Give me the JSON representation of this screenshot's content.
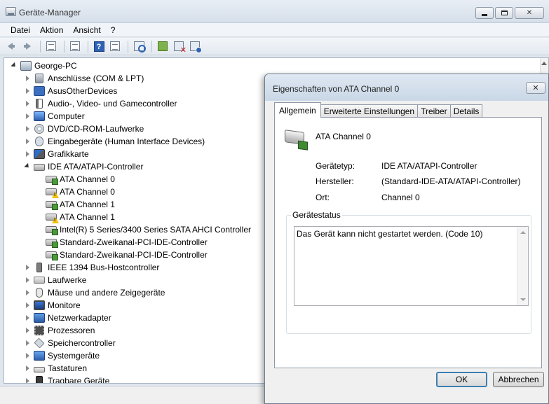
{
  "window": {
    "title": "Geräte-Manager"
  },
  "menu": [
    "Datei",
    "Aktion",
    "Ansicht",
    "?"
  ],
  "toolbar": {
    "buttons": [
      "back-icon",
      "forward-icon",
      "show-hide-console-tree-icon",
      "properties-icon",
      "help-icon",
      "action-pane-icon",
      "scan-hardware-icon",
      "update-driver-icon",
      "uninstall-icon",
      "disable-icon"
    ]
  },
  "tree": {
    "root": "George-PC",
    "items": [
      {
        "label": "Anschlüsse (COM & LPT)",
        "icon": "port"
      },
      {
        "label": "AsusOtherDevices",
        "icon": "misc"
      },
      {
        "label": "Audio-, Video- und Gamecontroller",
        "icon": "audio"
      },
      {
        "label": "Computer",
        "icon": "computer"
      },
      {
        "label": "DVD/CD-ROM-Laufwerke",
        "icon": "dvd"
      },
      {
        "label": "Eingabegeräte (Human Interface Devices)",
        "icon": "hid"
      },
      {
        "label": "Grafikkarte",
        "icon": "gpu"
      },
      {
        "label": "IDE ATA/ATAPI-Controller",
        "icon": "ide"
      },
      {
        "label": "IEEE 1394 Bus-Hostcontroller",
        "icon": "fw"
      },
      {
        "label": "Laufwerke",
        "icon": "drive"
      },
      {
        "label": "Mäuse und andere Zeigegeräte",
        "icon": "mouse"
      },
      {
        "label": "Monitore",
        "icon": "monitor"
      },
      {
        "label": "Netzwerkadapter",
        "icon": "net"
      },
      {
        "label": "Prozessoren",
        "icon": "cpu"
      },
      {
        "label": "Speichercontroller",
        "icon": "storage"
      },
      {
        "label": "Systemgeräte",
        "icon": "sys"
      },
      {
        "label": "Tastaturen",
        "icon": "kbd"
      },
      {
        "label": "Tragbare Geräte",
        "icon": "portable"
      }
    ],
    "ide_children": [
      {
        "label": "ATA Channel 0",
        "warning": false
      },
      {
        "label": "ATA Channel 0",
        "warning": true
      },
      {
        "label": "ATA Channel 1",
        "warning": false
      },
      {
        "label": "ATA Channel 1",
        "warning": true
      },
      {
        "label": "Intel(R) 5 Series/3400 Series SATA AHCI Controller",
        "warning": false
      },
      {
        "label": "Standard-Zweikanal-PCI-IDE-Controller",
        "warning": false
      },
      {
        "label": "Standard-Zweikanal-PCI-IDE-Controller",
        "warning": false
      }
    ]
  },
  "dialog": {
    "title": "Eigenschaften von ATA Channel 0",
    "close_label": "✕",
    "tabs": [
      "Allgemein",
      "Erweiterte Einstellungen",
      "Treiber",
      "Details"
    ],
    "active_tab": "Allgemein",
    "device_name": "ATA Channel 0",
    "props": [
      {
        "label": "Gerätetyp:",
        "value": "IDE ATA/ATAPI-Controller"
      },
      {
        "label": "Hersteller:",
        "value": "(Standard-IDE-ATA/ATAPI-Controller)"
      },
      {
        "label": "Ort:",
        "value": "Channel 0"
      }
    ],
    "status_group_title": "Gerätestatus",
    "status_text": "Das Gerät kann nicht gestartet werden. (Code 10)",
    "ok_label": "OK",
    "cancel_label": "Abbrechen"
  }
}
